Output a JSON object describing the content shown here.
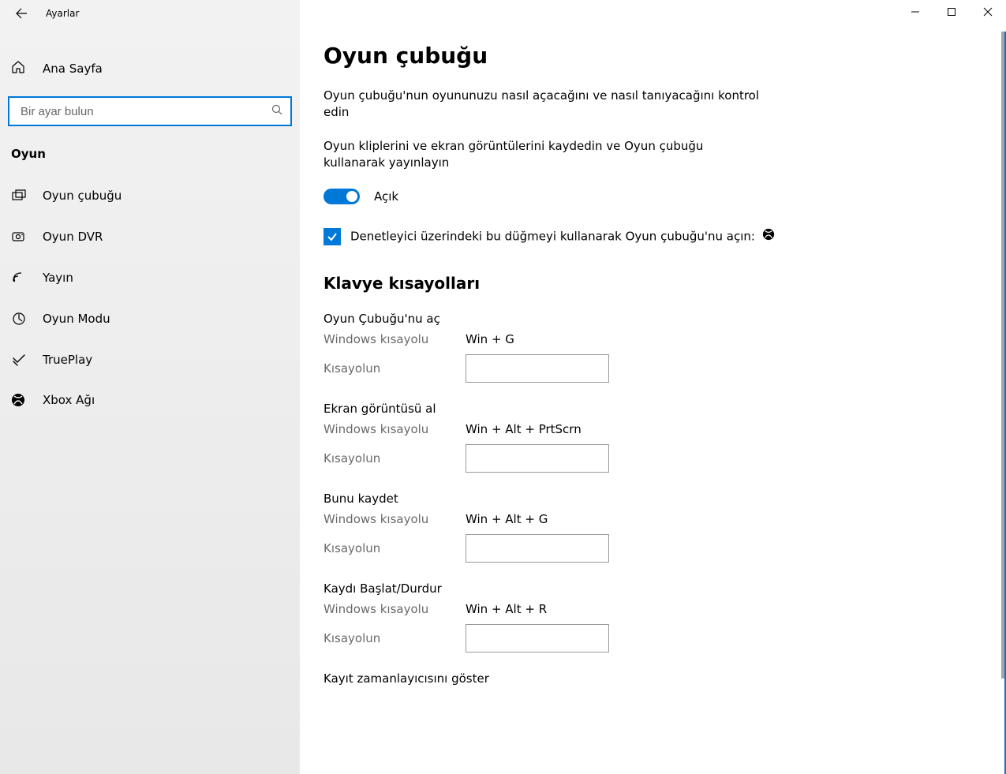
{
  "app_title": "Ayarlar",
  "home_label": "Ana Sayfa",
  "search_placeholder": "Bir ayar bulun",
  "category": "Oyun",
  "nav": [
    {
      "key": "gamebar",
      "label": "Oyun çubuğu"
    },
    {
      "key": "gamedvr",
      "label": "Oyun DVR"
    },
    {
      "key": "broadcast",
      "label": "Yayın"
    },
    {
      "key": "gamemode",
      "label": "Oyun Modu"
    },
    {
      "key": "trueplay",
      "label": "TruePlay"
    },
    {
      "key": "xboxnet",
      "label": "Xbox Ağı"
    }
  ],
  "page": {
    "title": "Oyun çubuğu",
    "desc1": "Oyun çubuğu'nun oyununuzu nasıl açacağını ve nasıl tanıyacağını kontrol edin",
    "desc2": "Oyun kliplerini ve ekran görüntülerini kaydedin ve Oyun çubuğu kullanarak yayınlayın",
    "toggle_label": "Açık",
    "checkbox_label": "Denetleyici üzerindeki bu düğmeyi kullanarak Oyun çubuğu'nu açın:",
    "shortcuts_header": "Klavye kısayolları",
    "win_shortcut_label": "Windows kısayolu",
    "your_shortcut_label": "Kısayolun",
    "shortcuts": [
      {
        "title": "Oyun Çubuğu'nu aç",
        "win": "Win + G",
        "user": ""
      },
      {
        "title": "Ekran görüntüsü al",
        "win": "Win + Alt + PrtScrn",
        "user": ""
      },
      {
        "title": "Bunu kaydet",
        "win": "Win + Alt + G",
        "user": ""
      },
      {
        "title": "Kaydı Başlat/Durdur",
        "win": "Win + Alt + R",
        "user": ""
      },
      {
        "title": "Kayıt zamanlayıcısını göster",
        "win": "",
        "user": ""
      }
    ]
  }
}
